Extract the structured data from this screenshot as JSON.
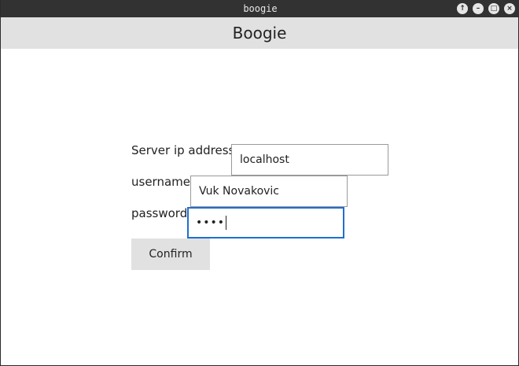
{
  "window": {
    "title": "boogie",
    "buttons": {
      "pin_icon": "arrow-up-icon",
      "minimize_icon": "minimize-icon",
      "maximize_icon": "maximize-icon",
      "close_icon": "close-icon",
      "pin_glyph": "↑",
      "minimize_glyph": "–",
      "maximize_glyph": "□",
      "close_glyph": "×"
    }
  },
  "header": {
    "title": "Boogie"
  },
  "form": {
    "server_label": "Server ip address:",
    "server_value": "localhost",
    "username_label": "username:",
    "username_value": "Vuk Novakovic",
    "password_label": "password:",
    "password_masked": "••••",
    "confirm_label": "Confirm"
  },
  "colors": {
    "header_bg": "#e1e1e1",
    "focus_border": "#1e6fd0",
    "button_bg": "#e1e1e1"
  }
}
